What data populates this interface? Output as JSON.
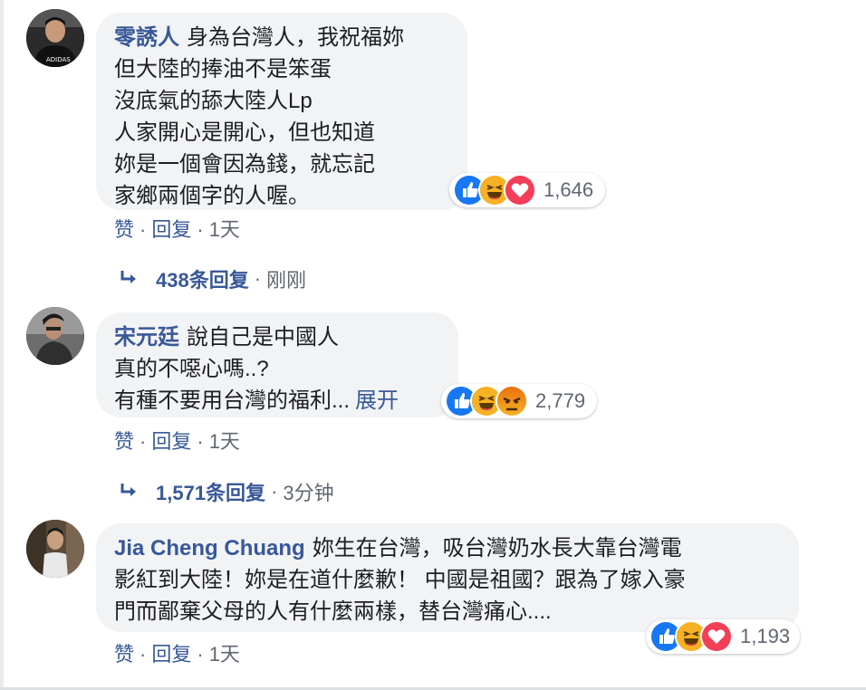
{
  "comments": [
    {
      "author": "零誘人",
      "lines": [
        "身為台灣人，我祝福妳",
        "但大陸的捧油不是笨蛋",
        "沒底氣的舔大陸人Lp",
        "人家開心是開心，但也知道",
        "妳是一個會因為錢，就忘記",
        "家鄉兩個字的人喔。"
      ],
      "expand_label": "",
      "reactions": [
        "like",
        "haha",
        "love"
      ],
      "reaction_count": "1,646",
      "like_label": "赞",
      "reply_label": "回复",
      "time": "1天",
      "replies_label": "438条回复",
      "replies_time": "刚刚"
    },
    {
      "author": "宋元廷",
      "lines": [
        "說自己是中國人",
        "真的不噁心嗎..?",
        "有種不要用台灣的福利..."
      ],
      "expand_label": "展开",
      "reactions": [
        "like",
        "haha",
        "angry"
      ],
      "reaction_count": "2,779",
      "like_label": "赞",
      "reply_label": "回复",
      "time": "1天",
      "replies_label": "1,571条回复",
      "replies_time": "3分钟"
    },
    {
      "author": "Jia Cheng Chuang",
      "lines": [
        "妳生在台灣，吸台灣奶水長大靠台灣電",
        "影紅到大陸！妳是在道什麼歉！ 中國是祖國？跟為了嫁入豪",
        "門而鄙棄父母的人有什麼兩樣，替台灣痛心...."
      ],
      "expand_label": "",
      "reactions": [
        "like",
        "haha",
        "love"
      ],
      "reaction_count": "1,193",
      "like_label": "赞",
      "reply_label": "回复",
      "time": "1天"
    }
  ],
  "colors": {
    "link": "#385898",
    "bubble": "#f2f3f5",
    "meta": "#606770",
    "like": "#1877f2",
    "haha": "#f7b125",
    "love": "#f33e58",
    "angry": "#e9710f"
  }
}
